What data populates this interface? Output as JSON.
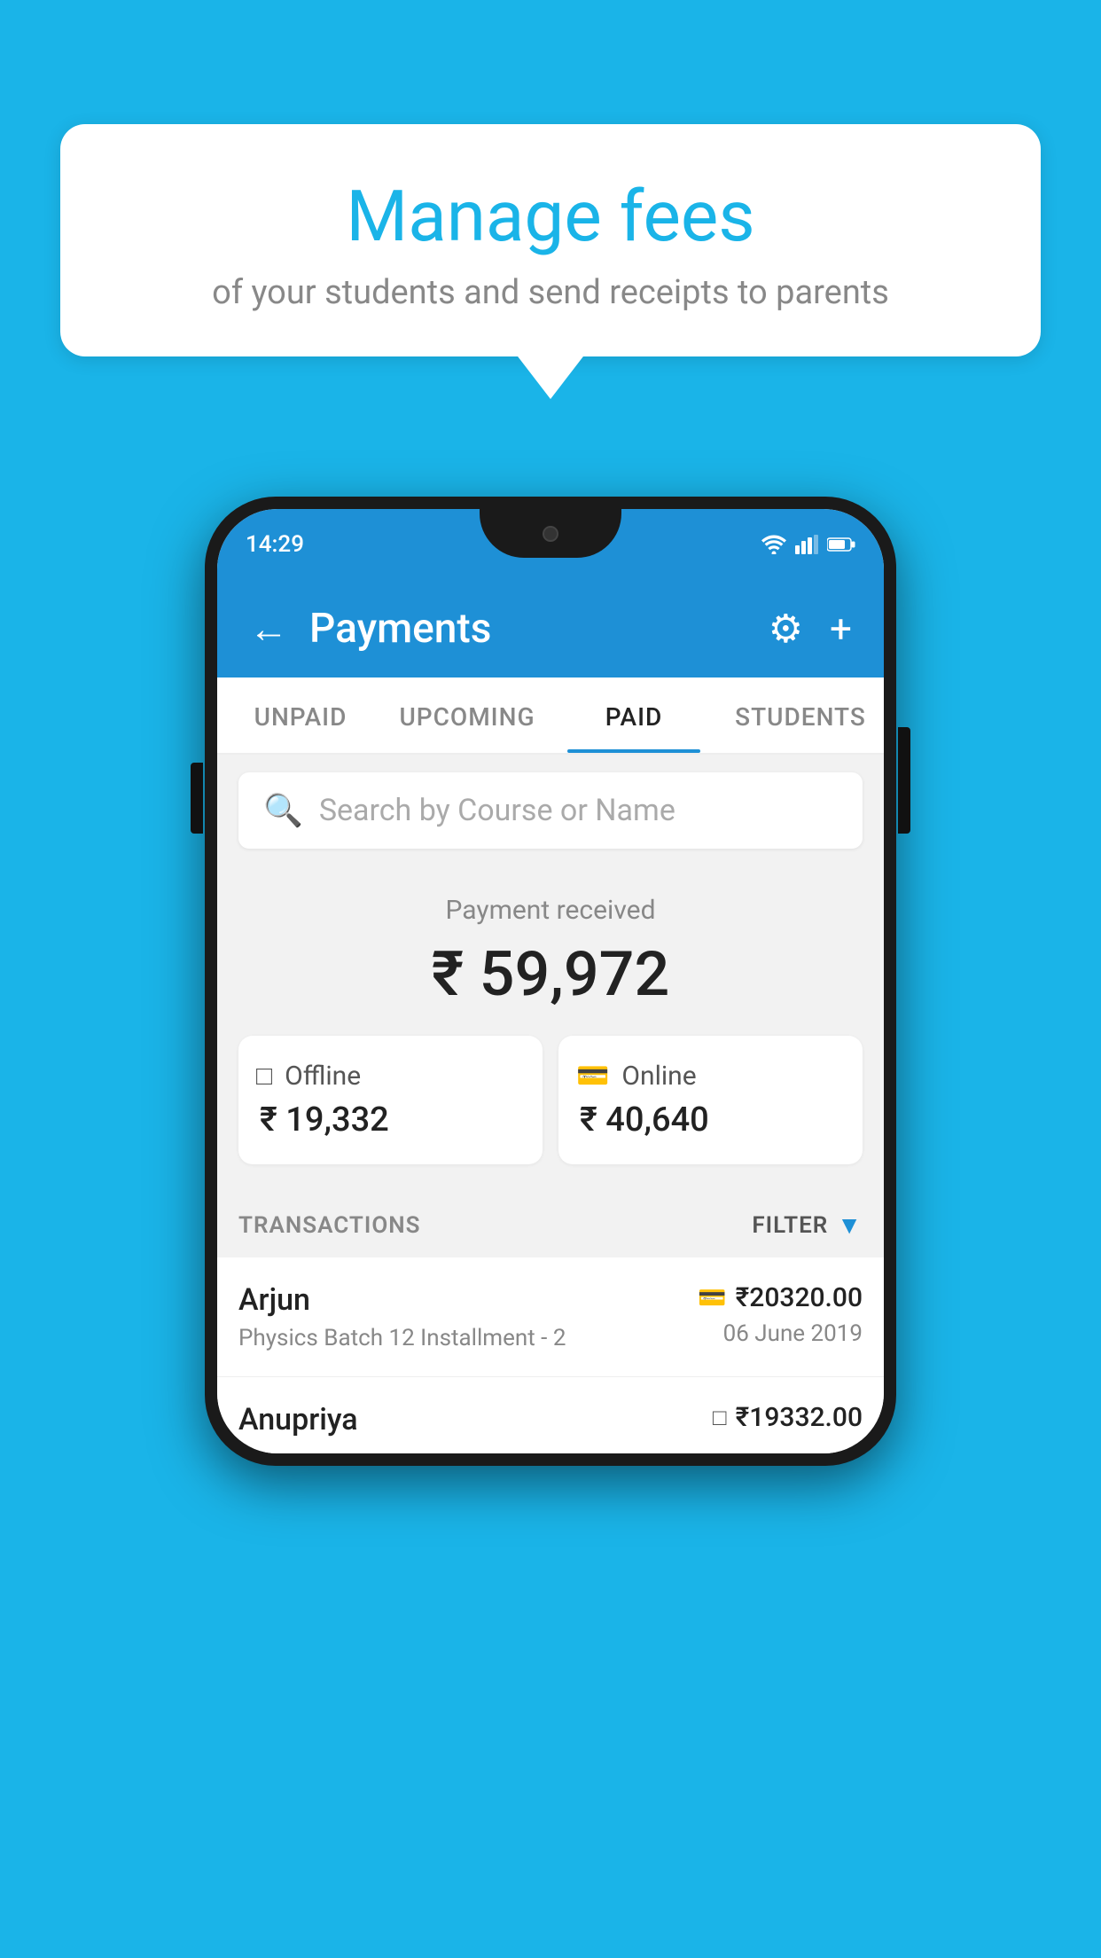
{
  "page": {
    "background_color": "#1ab4e8"
  },
  "speech_bubble": {
    "title": "Manage fees",
    "subtitle": "of your students and send receipts to parents"
  },
  "status_bar": {
    "time": "14:29"
  },
  "app_bar": {
    "title": "Payments",
    "back_label": "←",
    "settings_label": "⚙",
    "add_label": "+"
  },
  "tabs": [
    {
      "label": "UNPAID",
      "active": false
    },
    {
      "label": "UPCOMING",
      "active": false
    },
    {
      "label": "PAID",
      "active": true
    },
    {
      "label": "STUDENTS",
      "active": false
    }
  ],
  "search": {
    "placeholder": "Search by Course or Name"
  },
  "payment_summary": {
    "label": "Payment received",
    "total": "₹ 59,972",
    "offline_label": "Offline",
    "offline_amount": "₹ 19,332",
    "online_label": "Online",
    "online_amount": "₹ 40,640"
  },
  "transactions": {
    "header_label": "TRANSACTIONS",
    "filter_label": "FILTER",
    "rows": [
      {
        "name": "Arjun",
        "description": "Physics Batch 12 Installment - 2",
        "amount": "₹20320.00",
        "date": "06 June 2019",
        "payment_type": "card"
      },
      {
        "name": "Anupriya",
        "description": "",
        "amount": "₹19332.00",
        "date": "",
        "payment_type": "offline"
      }
    ]
  }
}
